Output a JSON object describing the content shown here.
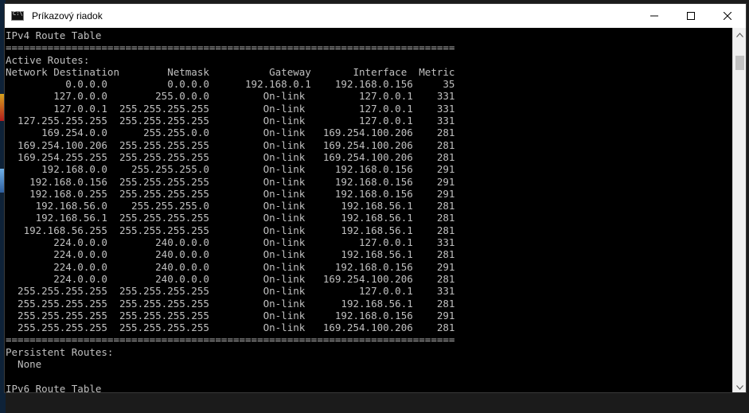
{
  "window": {
    "title": "Príkazový riadok",
    "icon": "console-icon",
    "controls": [
      "minimize-icon",
      "maximize-icon",
      "close-icon"
    ]
  },
  "console": {
    "text": "IPv4 Route Table\n===========================================================================\nActive Routes:\nNetwork Destination        Netmask          Gateway       Interface  Metric\n          0.0.0.0          0.0.0.0      192.168.0.1    192.168.0.156     35\n        127.0.0.0        255.0.0.0         On-link         127.0.0.1    331\n        127.0.0.1  255.255.255.255         On-link         127.0.0.1    331\n  127.255.255.255  255.255.255.255         On-link         127.0.0.1    331\n      169.254.0.0      255.255.0.0         On-link   169.254.100.206    281\n  169.254.100.206  255.255.255.255         On-link   169.254.100.206    281\n  169.254.255.255  255.255.255.255         On-link   169.254.100.206    281\n      192.168.0.0    255.255.255.0         On-link     192.168.0.156    291\n    192.168.0.156  255.255.255.255         On-link     192.168.0.156    291\n    192.168.0.255  255.255.255.255         On-link     192.168.0.156    291\n     192.168.56.0    255.255.255.0         On-link      192.168.56.1    281\n     192.168.56.1  255.255.255.255         On-link      192.168.56.1    281\n   192.168.56.255  255.255.255.255         On-link      192.168.56.1    281\n        224.0.0.0        240.0.0.0         On-link         127.0.0.1    331\n        224.0.0.0        240.0.0.0         On-link      192.168.56.1    281\n        224.0.0.0        240.0.0.0         On-link     192.168.0.156    291\n        224.0.0.0        240.0.0.0         On-link   169.254.100.206    281\n  255.255.255.255  255.255.255.255         On-link         127.0.0.1    331\n  255.255.255.255  255.255.255.255         On-link      192.168.56.1    281\n  255.255.255.255  255.255.255.255         On-link     192.168.0.156    291\n  255.255.255.255  255.255.255.255         On-link   169.254.100.206    281\n===========================================================================\nPersistent Routes:\n  None\n\nIPv6 Route Table"
  },
  "scrollbar": {
    "up_icon": "chevron-up-icon",
    "down_icon": "chevron-down-icon"
  },
  "colors": {
    "console_bg": "#000000",
    "console_fg": "#c0c0c0",
    "titlebar_bg": "#ffffff"
  }
}
